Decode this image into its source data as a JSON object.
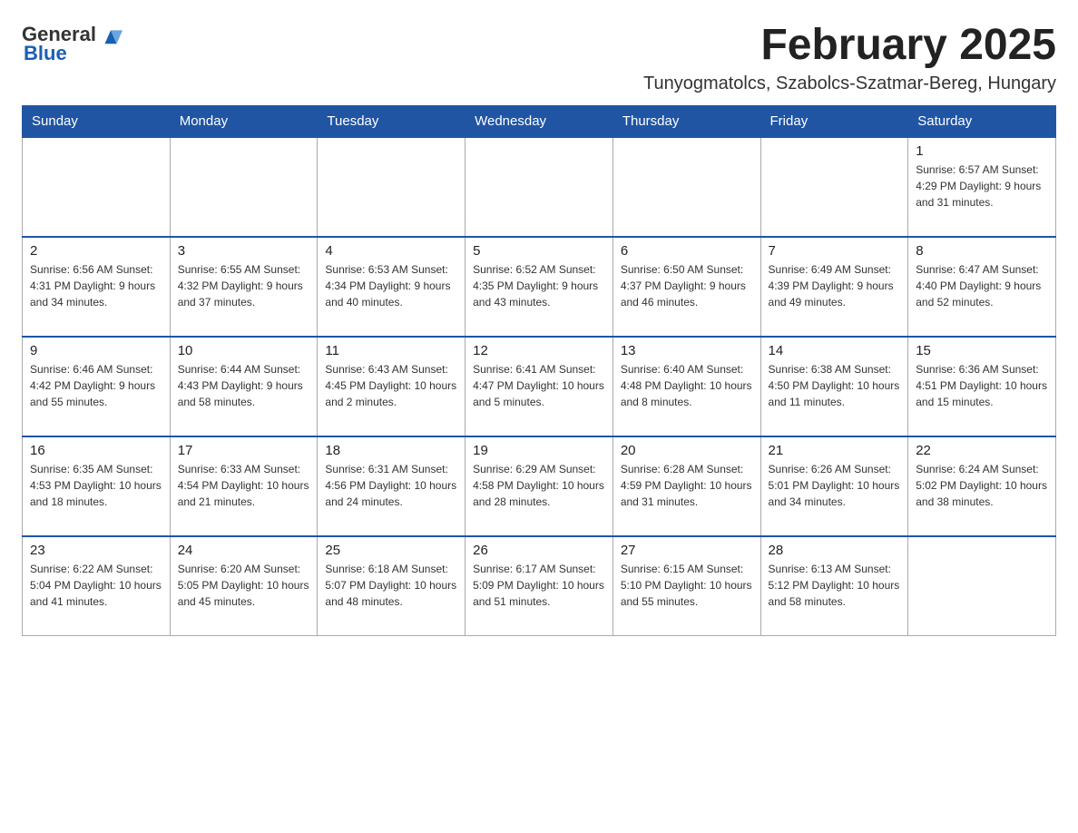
{
  "header": {
    "logo": {
      "general": "General",
      "blue": "Blue"
    },
    "month_title": "February 2025",
    "location": "Tunyogmatolcs, Szabolcs-Szatmar-Bereg, Hungary"
  },
  "days_of_week": [
    "Sunday",
    "Monday",
    "Tuesday",
    "Wednesday",
    "Thursday",
    "Friday",
    "Saturday"
  ],
  "weeks": [
    [
      {
        "day": "",
        "info": ""
      },
      {
        "day": "",
        "info": ""
      },
      {
        "day": "",
        "info": ""
      },
      {
        "day": "",
        "info": ""
      },
      {
        "day": "",
        "info": ""
      },
      {
        "day": "",
        "info": ""
      },
      {
        "day": "1",
        "info": "Sunrise: 6:57 AM\nSunset: 4:29 PM\nDaylight: 9 hours and 31 minutes."
      }
    ],
    [
      {
        "day": "2",
        "info": "Sunrise: 6:56 AM\nSunset: 4:31 PM\nDaylight: 9 hours and 34 minutes."
      },
      {
        "day": "3",
        "info": "Sunrise: 6:55 AM\nSunset: 4:32 PM\nDaylight: 9 hours and 37 minutes."
      },
      {
        "day": "4",
        "info": "Sunrise: 6:53 AM\nSunset: 4:34 PM\nDaylight: 9 hours and 40 minutes."
      },
      {
        "day": "5",
        "info": "Sunrise: 6:52 AM\nSunset: 4:35 PM\nDaylight: 9 hours and 43 minutes."
      },
      {
        "day": "6",
        "info": "Sunrise: 6:50 AM\nSunset: 4:37 PM\nDaylight: 9 hours and 46 minutes."
      },
      {
        "day": "7",
        "info": "Sunrise: 6:49 AM\nSunset: 4:39 PM\nDaylight: 9 hours and 49 minutes."
      },
      {
        "day": "8",
        "info": "Sunrise: 6:47 AM\nSunset: 4:40 PM\nDaylight: 9 hours and 52 minutes."
      }
    ],
    [
      {
        "day": "9",
        "info": "Sunrise: 6:46 AM\nSunset: 4:42 PM\nDaylight: 9 hours and 55 minutes."
      },
      {
        "day": "10",
        "info": "Sunrise: 6:44 AM\nSunset: 4:43 PM\nDaylight: 9 hours and 58 minutes."
      },
      {
        "day": "11",
        "info": "Sunrise: 6:43 AM\nSunset: 4:45 PM\nDaylight: 10 hours and 2 minutes."
      },
      {
        "day": "12",
        "info": "Sunrise: 6:41 AM\nSunset: 4:47 PM\nDaylight: 10 hours and 5 minutes."
      },
      {
        "day": "13",
        "info": "Sunrise: 6:40 AM\nSunset: 4:48 PM\nDaylight: 10 hours and 8 minutes."
      },
      {
        "day": "14",
        "info": "Sunrise: 6:38 AM\nSunset: 4:50 PM\nDaylight: 10 hours and 11 minutes."
      },
      {
        "day": "15",
        "info": "Sunrise: 6:36 AM\nSunset: 4:51 PM\nDaylight: 10 hours and 15 minutes."
      }
    ],
    [
      {
        "day": "16",
        "info": "Sunrise: 6:35 AM\nSunset: 4:53 PM\nDaylight: 10 hours and 18 minutes."
      },
      {
        "day": "17",
        "info": "Sunrise: 6:33 AM\nSunset: 4:54 PM\nDaylight: 10 hours and 21 minutes."
      },
      {
        "day": "18",
        "info": "Sunrise: 6:31 AM\nSunset: 4:56 PM\nDaylight: 10 hours and 24 minutes."
      },
      {
        "day": "19",
        "info": "Sunrise: 6:29 AM\nSunset: 4:58 PM\nDaylight: 10 hours and 28 minutes."
      },
      {
        "day": "20",
        "info": "Sunrise: 6:28 AM\nSunset: 4:59 PM\nDaylight: 10 hours and 31 minutes."
      },
      {
        "day": "21",
        "info": "Sunrise: 6:26 AM\nSunset: 5:01 PM\nDaylight: 10 hours and 34 minutes."
      },
      {
        "day": "22",
        "info": "Sunrise: 6:24 AM\nSunset: 5:02 PM\nDaylight: 10 hours and 38 minutes."
      }
    ],
    [
      {
        "day": "23",
        "info": "Sunrise: 6:22 AM\nSunset: 5:04 PM\nDaylight: 10 hours and 41 minutes."
      },
      {
        "day": "24",
        "info": "Sunrise: 6:20 AM\nSunset: 5:05 PM\nDaylight: 10 hours and 45 minutes."
      },
      {
        "day": "25",
        "info": "Sunrise: 6:18 AM\nSunset: 5:07 PM\nDaylight: 10 hours and 48 minutes."
      },
      {
        "day": "26",
        "info": "Sunrise: 6:17 AM\nSunset: 5:09 PM\nDaylight: 10 hours and 51 minutes."
      },
      {
        "day": "27",
        "info": "Sunrise: 6:15 AM\nSunset: 5:10 PM\nDaylight: 10 hours and 55 minutes."
      },
      {
        "day": "28",
        "info": "Sunrise: 6:13 AM\nSunset: 5:12 PM\nDaylight: 10 hours and 58 minutes."
      },
      {
        "day": "",
        "info": ""
      }
    ]
  ]
}
